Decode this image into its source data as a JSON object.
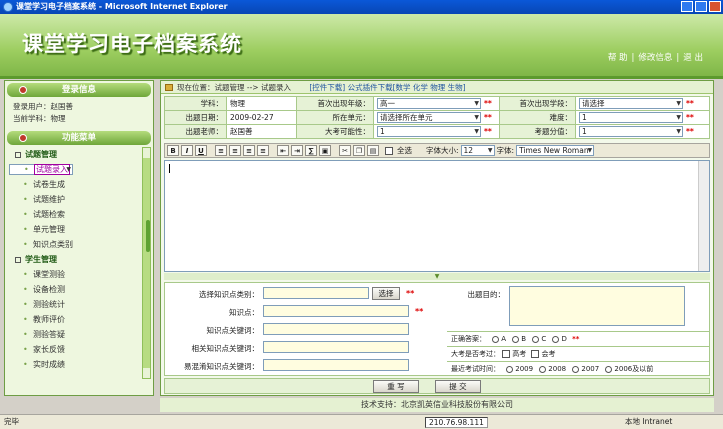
{
  "window": {
    "title": "课堂学习电子档案系统 - Microsoft Internet Explorer"
  },
  "header": {
    "app_title": "课堂学习电子档案系统",
    "menu": [
      "帮 助",
      "修改信息",
      "退 出"
    ]
  },
  "login": {
    "heading": "登录信息",
    "user_line": "登录用户：赵国善",
    "subject_line": "当前学科：物理"
  },
  "function_menu": {
    "heading": "功能菜单",
    "groups": [
      {
        "label": "试题管理",
        "items": [
          "试题录入",
          "试卷生成",
          "试题维护",
          "试题检索",
          "单元管理",
          "知识点类别"
        ]
      },
      {
        "label": "学生管理",
        "items": [
          "课堂测验",
          "设备检测",
          "测验统计",
          "教师评价",
          "测验答疑",
          "家长反馈",
          "实时成绩"
        ]
      }
    ]
  },
  "breadcrumb": {
    "text": "现在位置：试题管理 --> 试题录入",
    "links": "[控件下载] 公式插件下载[数学 化学 物理 生物]"
  },
  "form": {
    "subject_label": "学科：",
    "subject_value": "物理",
    "first_grade_label": "首次出现年级：",
    "first_grade_value": "高一",
    "first_term_label": "首次出现学段：",
    "first_term_value": "请选择",
    "date_label": "出题日期：",
    "date_value": "2009-02-27",
    "unit_label": "所在单元：",
    "unit_value": "请选择所在单元",
    "difficulty_label": "难度：",
    "difficulty_value": "1",
    "teacher_label": "出题老师：",
    "teacher_value": "赵国善",
    "possibility_label": "大考可能性：",
    "possibility_value": "1",
    "score_label": "考题分值：",
    "score_value": "1",
    "star": "**"
  },
  "toolbar": {
    "bold": "B",
    "italic": "I",
    "underline": "U",
    "select_all": "全选",
    "font_size_label": "字体大小:",
    "font_size_value": "12",
    "font_label": "字体:",
    "font_value": "Times New Roman"
  },
  "lower": {
    "kp_category_label": "选择知识点类别：",
    "select_button": "选择",
    "kp_label": "知识点：",
    "kp_keyword_label": "知识点关键词：",
    "related_kp_label": "相关知识点关键词：",
    "confusable_kp_label": "易混淆知识点关键词：",
    "purpose_label": "出题目的：",
    "answer_label": "正确答案：",
    "answer_options": [
      "A",
      "B",
      "C",
      "D"
    ],
    "exam_label": "大考是否考过：",
    "exam_options": [
      "高考",
      "会考"
    ],
    "recent_label": "最近考试时间：",
    "recent_options": [
      "2009",
      "2008",
      "2007",
      "2006及以前"
    ],
    "rewrite_button": "重 写",
    "submit_button": "提 交"
  },
  "footer": {
    "text": "技术支持：北京凯英信业科技股份有限公司"
  },
  "status": {
    "left": "完毕",
    "ip": "210.76.98.111",
    "zone": "本地 Intranet"
  }
}
